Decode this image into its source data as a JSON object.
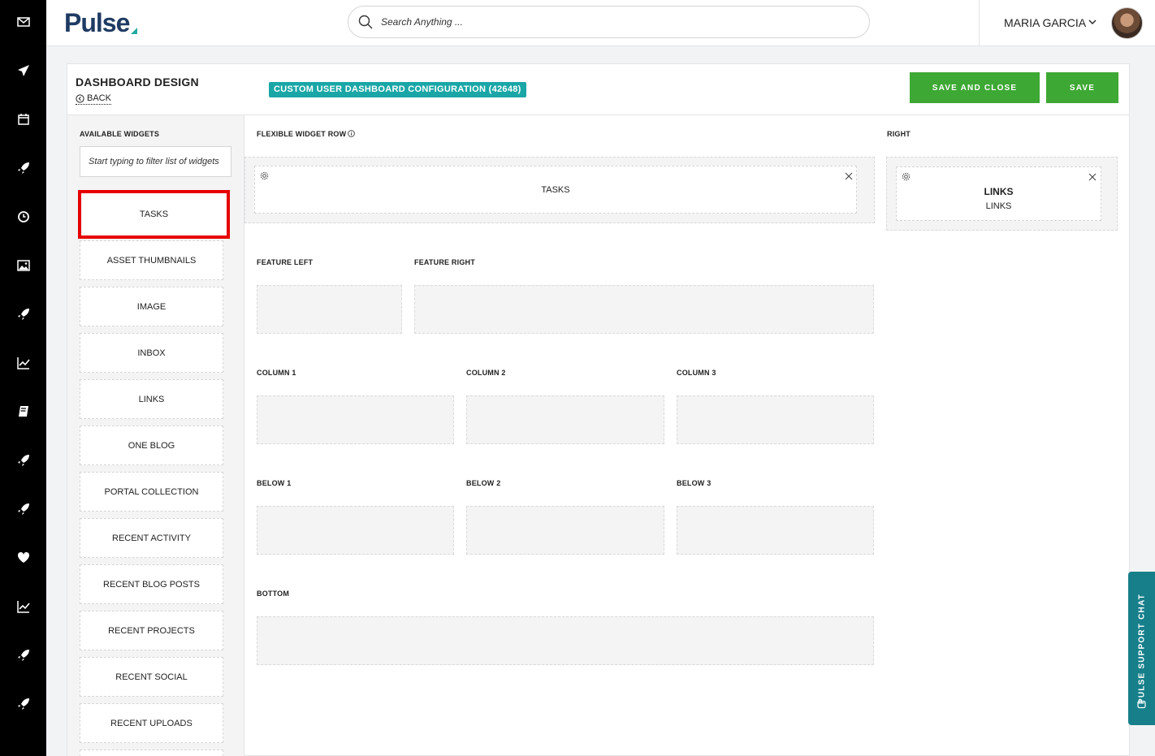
{
  "header": {
    "logo": "Pulse",
    "search_placeholder": "Search Anything ...",
    "user_name": "MARIA GARCIA"
  },
  "rail": {
    "items": [
      "envelope-icon",
      "paper-plane-icon",
      "calendar-icon",
      "rocket-icon",
      "clock-icon",
      "image-icon",
      "rocket-icon",
      "chart-line-icon",
      "book-icon",
      "rocket-icon",
      "rocket-icon",
      "heart-icon",
      "chart-line-icon",
      "rocket-icon",
      "rocket-icon"
    ]
  },
  "page": {
    "title": "DASHBOARD DESIGN",
    "back_label": "BACK",
    "config_badge": "CUSTOM USER DASHBOARD CONFIGURATION (42648)",
    "save_close_label": "SAVE AND CLOSE",
    "save_label": "SAVE"
  },
  "sidebar": {
    "title": "AVAILABLE WIDGETS",
    "filter_placeholder": "Start typing to filter list of widgets",
    "widgets": [
      "TASKS",
      "ASSET THUMBNAILS",
      "IMAGE",
      "INBOX",
      "LINKS",
      "ONE BLOG",
      "PORTAL COLLECTION",
      "RECENT ACTIVITY",
      "RECENT BLOG POSTS",
      "RECENT PROJECTS",
      "RECENT SOCIAL",
      "RECENT UPLOADS"
    ]
  },
  "zones": {
    "flexible_row": "FLEXIBLE WIDGET ROW",
    "right": "RIGHT",
    "feature_left": "FEATURE LEFT",
    "feature_right": "FEATURE RIGHT",
    "column_1": "COLUMN 1",
    "column_2": "COLUMN 2",
    "column_3": "COLUMN 3",
    "below_1": "BELOW 1",
    "below_2": "BELOW 2",
    "below_3": "BELOW 3",
    "bottom": "BOTTOM"
  },
  "placed": {
    "flexible_widget": "TASKS",
    "right_widget_title": "LINKS",
    "right_widget_subtitle": "LINKS"
  },
  "support_chat": "PULSE SUPPORT CHAT",
  "colors": {
    "primary_green": "#3ea834",
    "teal_badge": "#1aa6a6",
    "highlight_red": "#e60000",
    "support_teal": "#167f8a"
  }
}
